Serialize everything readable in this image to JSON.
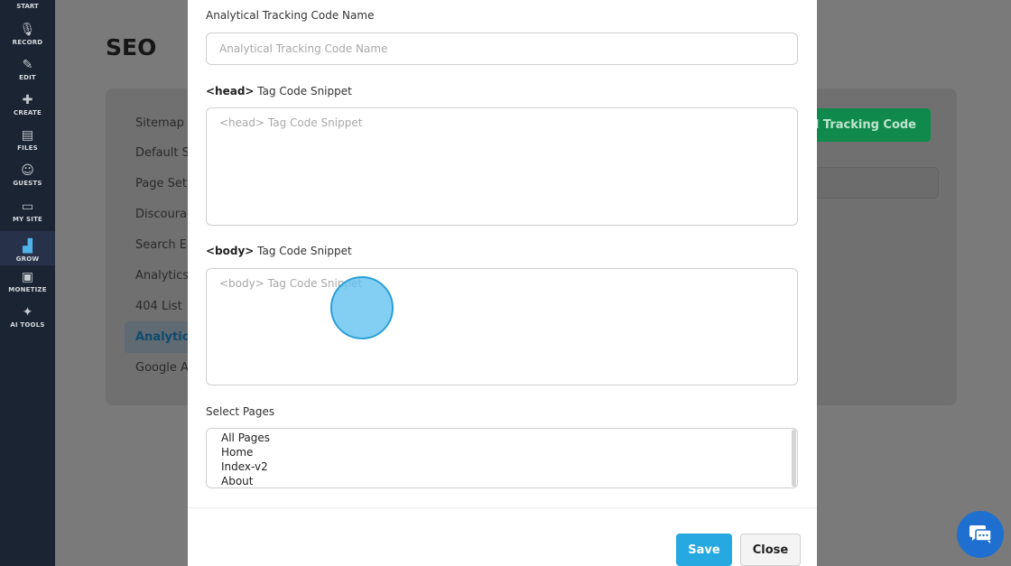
{
  "sidebar": {
    "start_label": "START",
    "items": [
      {
        "label": "RECORD",
        "icon": "microphone-icon",
        "glyph": "🎙"
      },
      {
        "label": "EDIT",
        "icon": "edit-icon",
        "glyph": "✎"
      },
      {
        "label": "CREATE",
        "icon": "create-icon",
        "glyph": "✚"
      },
      {
        "label": "FILES",
        "icon": "files-icon",
        "glyph": "▤"
      },
      {
        "label": "GUESTS",
        "icon": "guests-icon",
        "glyph": "☺"
      },
      {
        "label": "MY SITE",
        "icon": "site-icon",
        "glyph": "▭"
      },
      {
        "label": "GROW",
        "icon": "bar-chart-icon",
        "glyph": "▟"
      },
      {
        "label": "MONETIZE",
        "icon": "monetize-icon",
        "glyph": "▣"
      },
      {
        "label": "AI TOOLS",
        "icon": "ai-tools-icon",
        "glyph": "✦"
      }
    ]
  },
  "background": {
    "page_title": "SEO",
    "menu": [
      "Sitemap G",
      "Default Se",
      "Page Setti",
      "Discourag",
      "Search En",
      "Analytics",
      "404 List",
      "Analytical",
      "Google Ad"
    ],
    "active_menu_index": 7,
    "add_button_label": "cal Tracking Code"
  },
  "modal": {
    "name_label": "Analytical Tracking Code Name",
    "name_placeholder": "Analytical Tracking Code Name",
    "head_label_bold": "<head>",
    "head_label_rest": " Tag Code Snippet",
    "head_placeholder": "<head> Tag Code Snippet",
    "body_label_bold": "<body>",
    "body_label_rest": " Tag Code Snippet",
    "body_placeholder": "<body> Tag Code Snippet",
    "pages_label": "Select Pages",
    "pages_options": [
      "All Pages",
      "Home",
      "Index-v2",
      "About"
    ],
    "save_label": "Save",
    "close_label": "Close"
  },
  "colors": {
    "accent": "#26a8e0",
    "sidebar_bg": "#1b2432",
    "green_button": "#0f8a4c",
    "chat": "#1e6fd0"
  }
}
